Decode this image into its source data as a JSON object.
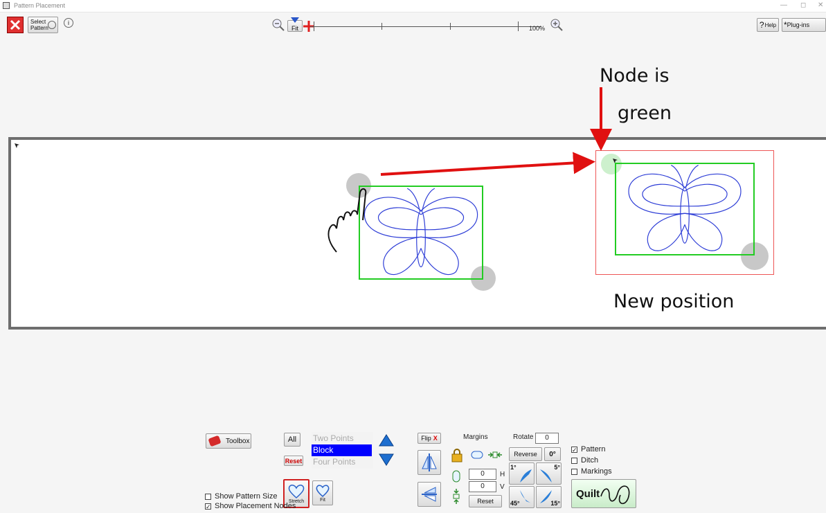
{
  "window": {
    "title": "Pattern Placement",
    "controls": {
      "minimize": "—",
      "maximize": "◻",
      "close": "✕"
    }
  },
  "toolbar": {
    "select_pattern_line1": "Select",
    "select_pattern_line2": "Pattern",
    "zoom_fit_label": "Fit",
    "zoom_100_label": "100%",
    "help_label": "Help",
    "plugins_label": "Plug-ins"
  },
  "annotations": {
    "node_is_line1": "Node is",
    "node_is_line2": "green",
    "new_position": "New position"
  },
  "bottom": {
    "toolbox_label": "Toolbox",
    "all_label": "All",
    "reset_label": "Reset",
    "placement_modes": [
      {
        "label": "Two Points",
        "selected": false
      },
      {
        "label": "Block",
        "selected": true
      },
      {
        "label": "Four Points",
        "selected": false
      }
    ],
    "stretch_label": "Stretch",
    "fit_label": "Fit",
    "show_pattern_size": {
      "label": "Show Pattern Size",
      "checked": false
    },
    "show_placement_nodes": {
      "label": "Show Placement Nodes",
      "checked": true
    },
    "flip_label": "Flip",
    "flip_x": "X",
    "margins_label": "Margins",
    "margin_h_value": "0",
    "margin_h_label": "H",
    "margin_v_value": "0",
    "margin_v_label": "V",
    "margins_reset_label": "Reset",
    "rotate_label": "Rotate",
    "rotate_value": "0",
    "reverse_label": "Reverse",
    "zero_deg_label": "0°",
    "rot_1": "1°",
    "rot_5": "5°",
    "rot_45": "45°",
    "rot_15": "15°",
    "layers": [
      {
        "label": "Pattern",
        "checked": true
      },
      {
        "label": "Ditch",
        "checked": false
      },
      {
        "label": "Markings",
        "checked": false
      }
    ],
    "quilt_label": "Quilt"
  },
  "colors": {
    "pattern_stroke": "#2b3bd6",
    "bounding_box": "#22cc22",
    "annotation_arrow": "#e01010",
    "selected_mode": "#0000ff"
  }
}
